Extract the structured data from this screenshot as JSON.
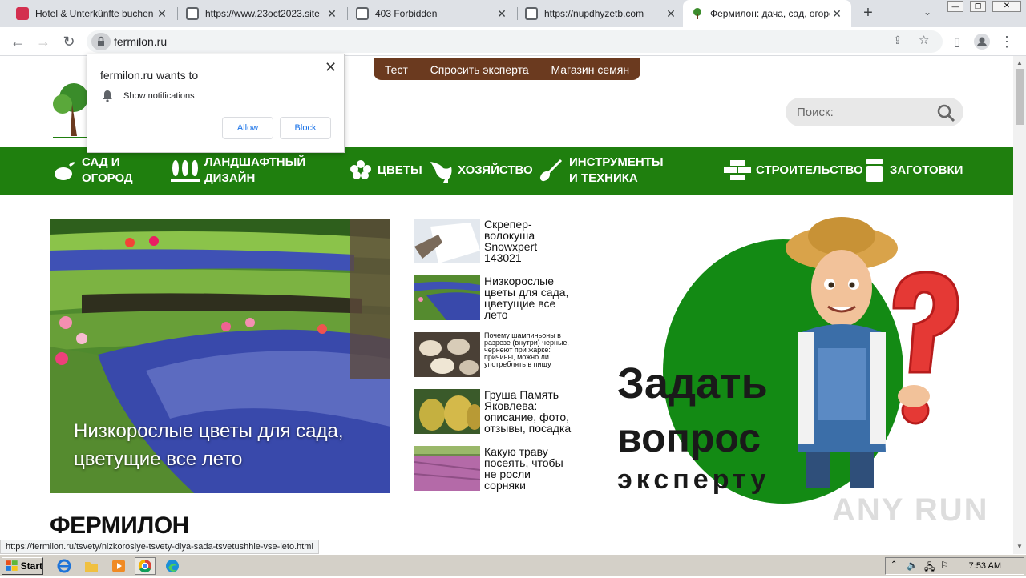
{
  "browser": {
    "tabs": [
      {
        "title": "Hotel & Unterkünfte buchen | A",
        "active": false
      },
      {
        "title": "https://www.23oct2023.site",
        "active": false
      },
      {
        "title": "403 Forbidden",
        "active": false
      },
      {
        "title": "https://nupdhyzetb.com",
        "active": false
      },
      {
        "title": "Фермилон: дача, сад, огород",
        "active": true
      }
    ],
    "new_tab": "+",
    "url": "fermilon.ru"
  },
  "notification": {
    "question": "fermilon.ru wants to",
    "permission": "Show notifications",
    "allow": "Allow",
    "block": "Block"
  },
  "site": {
    "top_menu": [
      "Тест",
      "Спросить эксперта",
      "Магазин семян"
    ],
    "search_placeholder": "Поиск:",
    "nav": [
      {
        "label": "Сад и огород",
        "icon": "vegetable-icon"
      },
      {
        "label": "Ландшафтный дизайн",
        "icon": "trees-icon"
      },
      {
        "label": "Цветы",
        "icon": "flower-icon"
      },
      {
        "label": "Хозяйство",
        "icon": "rooster-icon"
      },
      {
        "label": "Инструменты и техника",
        "icon": "shovel-icon"
      },
      {
        "label": "Строительство",
        "icon": "bricks-icon"
      },
      {
        "label": "Заготовки",
        "icon": "jar-icon"
      }
    ],
    "hero_title": "Низкорослые цветы для сада, цветущие все лето",
    "side_articles": [
      {
        "title": "Скрепер-волокуша Snowxpert 143021"
      },
      {
        "title": "Низкорослые цветы для сада, цветущие все лето"
      },
      {
        "title": "Почему шампиньоны в разрезе (внутри) черные, чернеют при жарке: причины, можно ли употреблять в пищу"
      },
      {
        "title": "Груша Память Яковлева: описание, фото, отзывы, посадка"
      },
      {
        "title": "Какую траву посеять, чтобы не росли сорняки"
      }
    ],
    "ask": {
      "line1": "Задать",
      "line2": "вопрос",
      "line3": "эксперту"
    },
    "brand": "ФЕРМИЛОН",
    "watermark": "ANY RUN"
  },
  "status_url": "https://fermilon.ru/tsvety/nizkoroslye-tsvety-dlya-sada-tsvetushhie-vse-leto.html",
  "taskbar": {
    "start": "Start",
    "time": "7:53 AM"
  }
}
